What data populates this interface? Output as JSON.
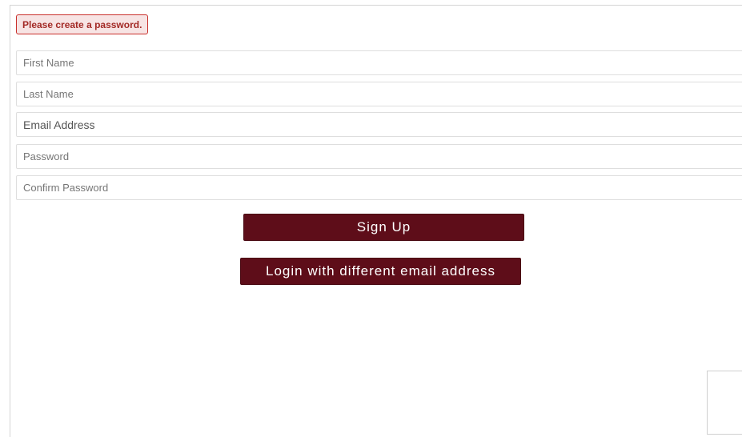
{
  "form": {
    "error_message": "Please create a password.",
    "fields": {
      "first_name": {
        "placeholder": "First Name",
        "value": ""
      },
      "last_name": {
        "placeholder": "Last Name",
        "value": ""
      },
      "email": {
        "placeholder": "Email Address",
        "value": ""
      },
      "password": {
        "placeholder": "Password",
        "value": ""
      },
      "confirm_password": {
        "placeholder": "Confirm Password",
        "value": ""
      }
    },
    "signup_label": "Sign Up",
    "login_label": "Login with different email address"
  },
  "colors": {
    "button_bg": "#5e0d19",
    "error_text": "#a32a26",
    "error_bg": "#f7e4e4",
    "field_border": "#dedede"
  }
}
